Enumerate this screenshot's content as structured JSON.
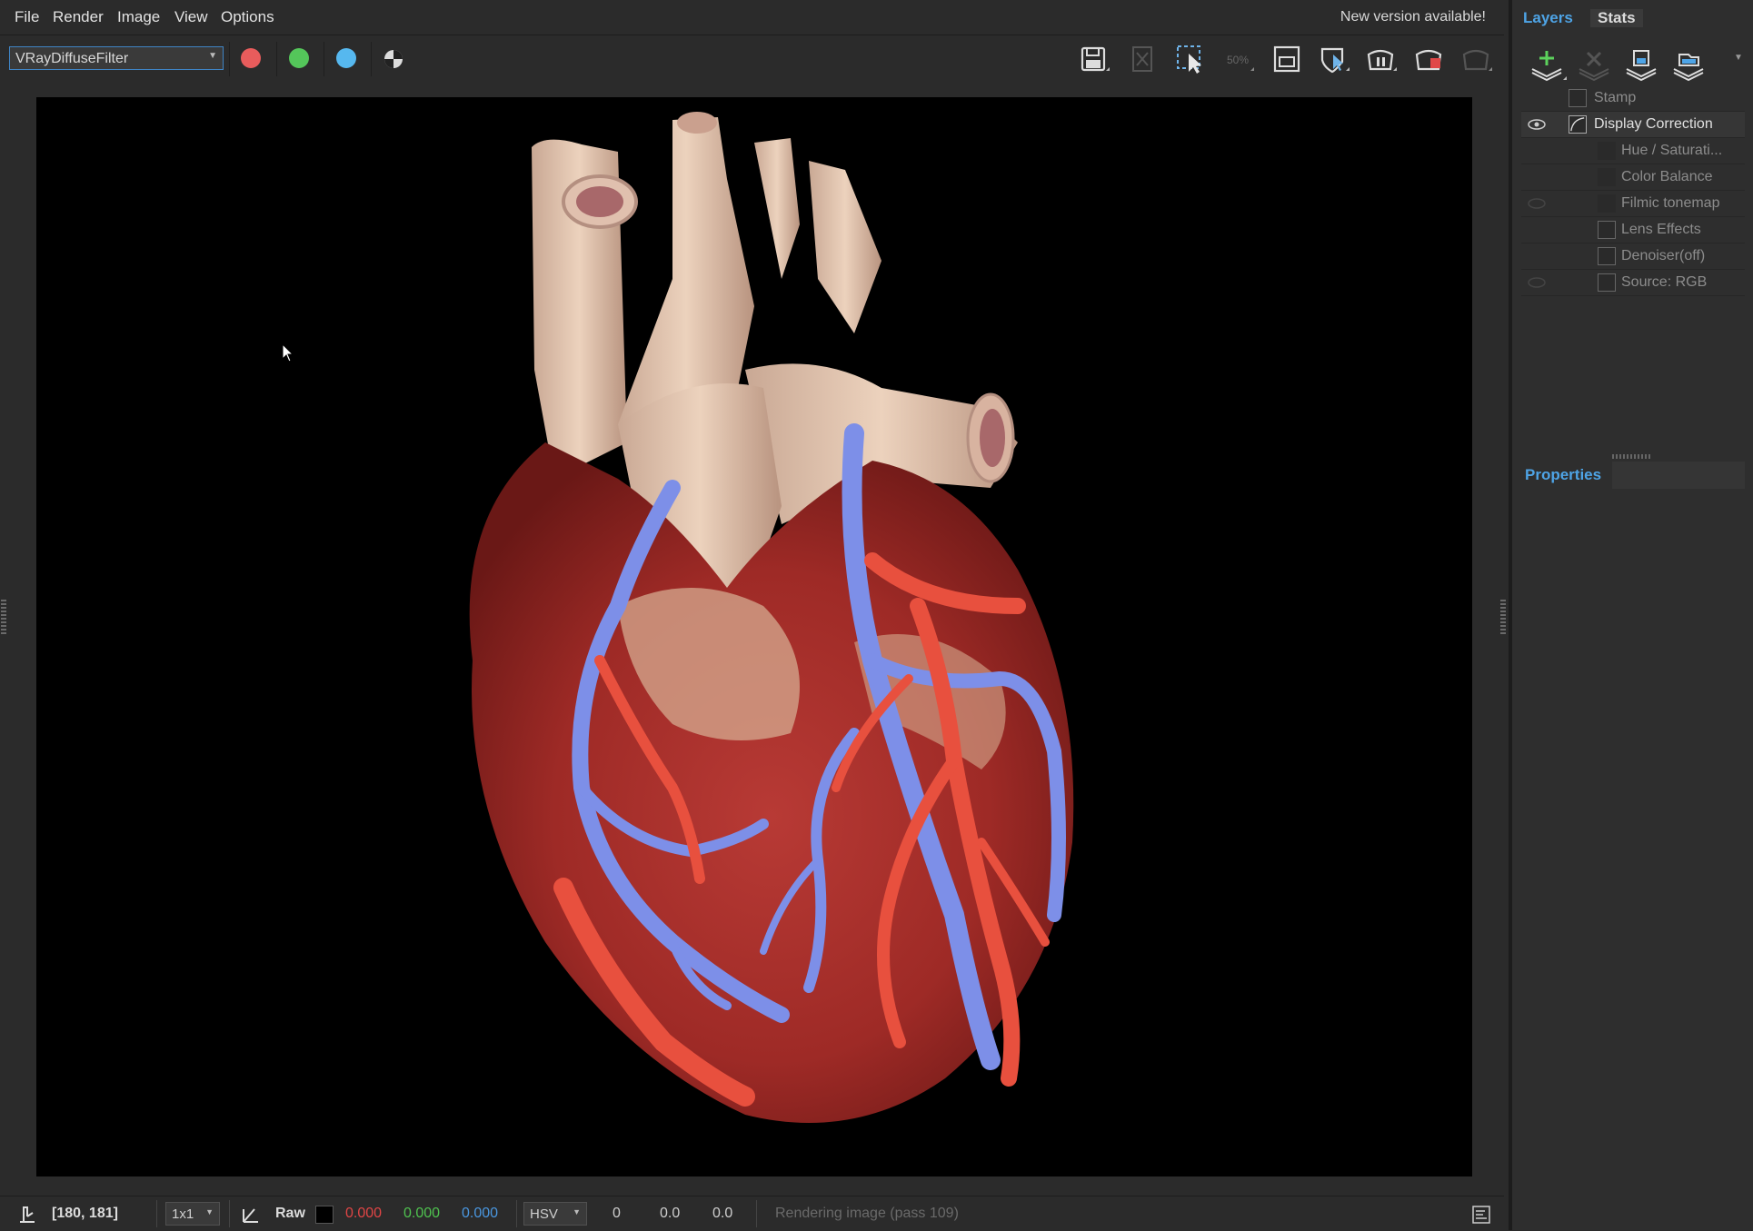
{
  "menu": [
    "File",
    "Render",
    "Image",
    "View",
    "Options"
  ],
  "notification": "New version available!",
  "toolbar": {
    "channel": "VRayDiffuseFilter",
    "colors": {
      "red": "#e85c5c",
      "green": "#54c65a",
      "blue": "#56b8ef"
    },
    "zoom_label": "50%"
  },
  "status": {
    "coords": "[180, 181]",
    "sample_size": "1x1",
    "mode": "Raw",
    "r": "0.000",
    "g": "0.000",
    "b": "0.000",
    "color_space": "HSV",
    "h": "0",
    "s": "0.0",
    "v": "0.0",
    "message": "Rendering image (pass 109)",
    "colors": {
      "r": "#e04545",
      "g": "#4fc24f",
      "b": "#4a97e0"
    }
  },
  "panel": {
    "tabs": [
      "Layers",
      "Stats"
    ],
    "active_tab_color": "#4ea4e6",
    "layers": [
      {
        "label": "Stamp",
        "visible": false,
        "indent": 0,
        "icon": "stamp-icon"
      },
      {
        "label": "Display Correction",
        "visible": true,
        "indent": 0,
        "icon": "curve-icon"
      },
      {
        "label": "Hue / Saturati...",
        "visible": false,
        "indent": 1,
        "icon": "hue-icon"
      },
      {
        "label": "Color Balance",
        "visible": false,
        "indent": 1,
        "icon": "balance-icon"
      },
      {
        "label": "Filmic tonemap",
        "visible": false,
        "indent": 1,
        "icon": "curve-icon"
      },
      {
        "label": "Lens Effects",
        "visible": false,
        "indent": 1,
        "icon": "lens-icon"
      },
      {
        "label": "Denoiser(off)",
        "visible": false,
        "indent": 1,
        "icon": "denoiser-icon"
      },
      {
        "label": "Source: RGB",
        "visible": false,
        "indent": 1,
        "icon": "source-icon"
      }
    ],
    "properties_label": "Properties"
  }
}
